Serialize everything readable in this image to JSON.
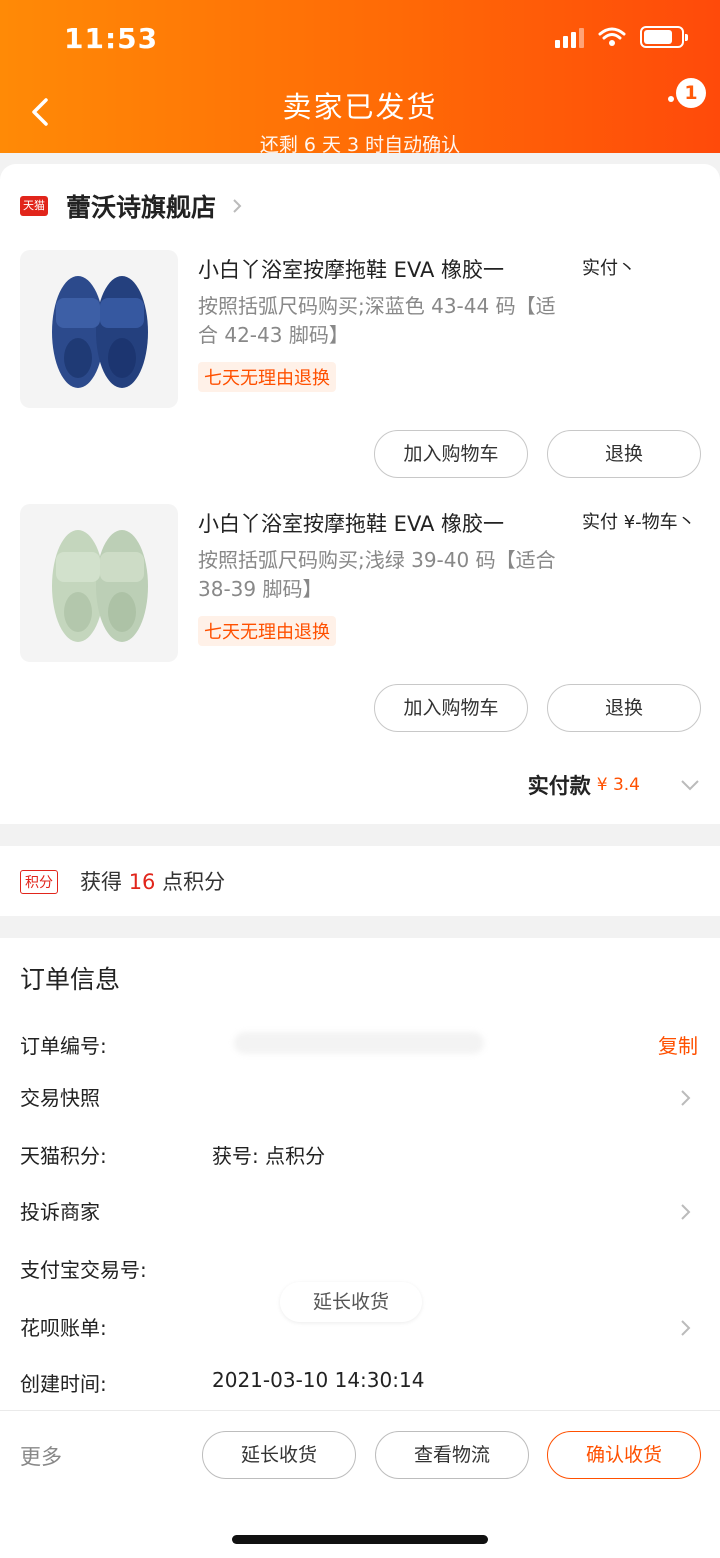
{
  "status_bar": {
    "time": "11:53"
  },
  "header": {
    "title": "卖家已发货",
    "subtitle": "还剩 6 天 3 时自动确认",
    "badge_count": "1"
  },
  "store": {
    "logo_text": "天猫",
    "name": "蕾沃诗旗舰店"
  },
  "products": [
    {
      "title": "小白丫浴室按摩拖鞋 EVA 橡胶一",
      "paid_label": "实付丶",
      "spec": "按照括弧尺码购买;深蓝色 43-44 码【适合 42-43 脚码】",
      "tag": "七天无理由退换",
      "cart_label": "加入购物车",
      "refund_label": "退换",
      "color": "#2c4a8c"
    },
    {
      "title": "小白丫浴室按摩拖鞋 EVA 橡胶一",
      "paid_label": "实付 ¥-物车丶",
      "spec": "按照括弧尺码购买;浅绿 39-40 码【适合 38-39 脚码】",
      "tag": "七天无理由退换",
      "cart_label": "加入购物车",
      "refund_label": "退换",
      "color": "#c8d8c2"
    }
  ],
  "total": {
    "label": "实付款",
    "value": "¥ 3.4"
  },
  "points": {
    "tag": "积分",
    "prefix": "获得",
    "num": "16",
    "suffix": "点积分"
  },
  "order_info": {
    "title": "订单信息",
    "rows": [
      {
        "key": "订单编号:",
        "action": "复制"
      },
      {
        "key": "交易快照",
        "value": ""
      },
      {
        "key": "天猫积分:",
        "value": "获号: 点积分"
      },
      {
        "key": "投诉商家",
        "value": ""
      },
      {
        "key": "支付宝交易号:",
        "value": ""
      },
      {
        "key": "花呗账单:",
        "value": ""
      },
      {
        "key": "创建时间:",
        "value": "2021-03-10 14:30:14"
      }
    ],
    "float_label": "延长收货"
  },
  "bottom_bar": {
    "more": "更多",
    "btn_extend": "延长收货",
    "btn_logistics": "查看物流",
    "btn_confirm": "确认收货"
  }
}
